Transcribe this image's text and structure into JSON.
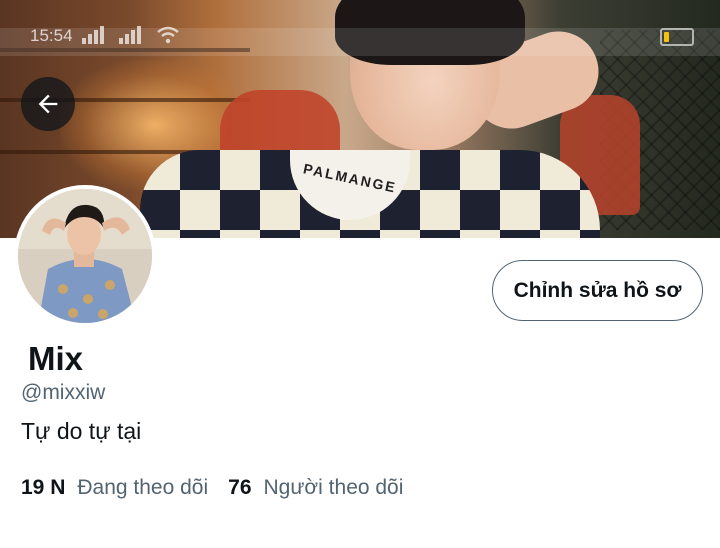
{
  "status_bar": {
    "time": "15:54",
    "battery_level": 0.2,
    "battery_color": "#f3c10f"
  },
  "banner": {
    "collar_text": "PALMANGE"
  },
  "profile": {
    "edit_button_label": "Chỉnh sửa hồ sơ",
    "display_name": "Mix",
    "handle": "@mixxiw",
    "bio": "Tự do tự tại",
    "following_count": "19 N",
    "following_label": "Đang theo dõi",
    "followers_count": "76",
    "followers_label": "Người theo dõi"
  },
  "icons": {
    "back": "arrow-left-icon",
    "signal": "signal-icon",
    "wifi": "wifi-icon",
    "battery": "battery-icon"
  },
  "colors": {
    "text_primary": "#0f1419",
    "text_secondary": "#536471",
    "button_border": "#536471",
    "background": "#ffffff"
  }
}
